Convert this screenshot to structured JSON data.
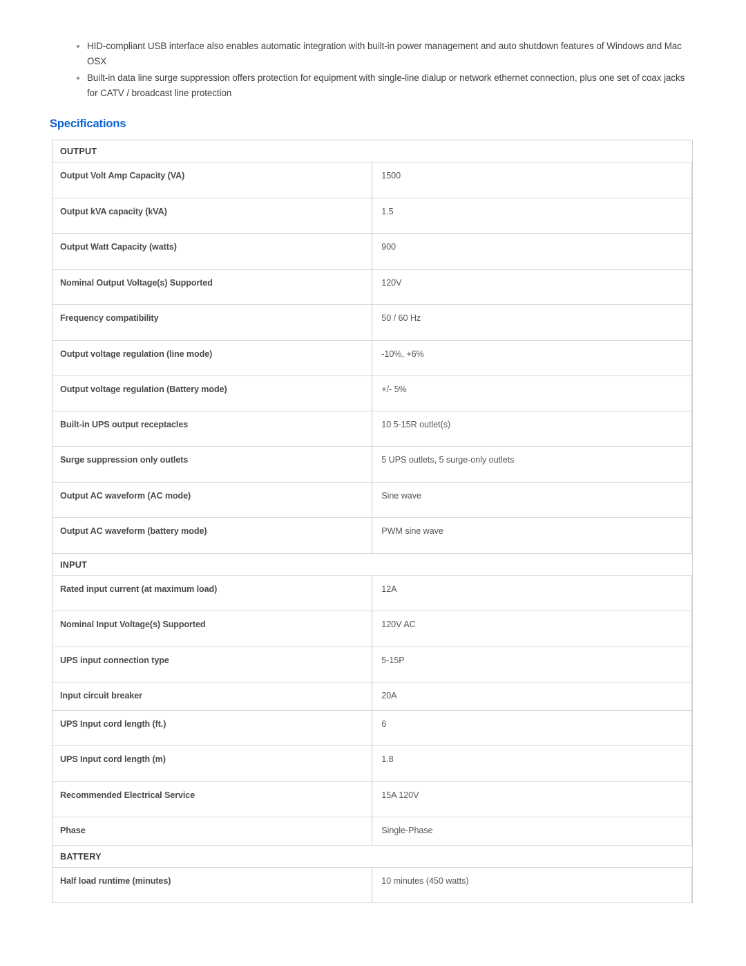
{
  "features": [
    "HID-compliant USB interface also enables automatic integration with built-in power management and auto shutdown features of Windows and Mac OSX",
    "Built-in data line surge suppression offers protection for equipment with single-line dialup or network ethernet connection, plus one set of coax jacks for CATV / broadcast line protection"
  ],
  "specifications": {
    "heading": "Specifications",
    "heading_color": "#0b63d0",
    "groups": [
      {
        "title": "OUTPUT",
        "rows": [
          {
            "label": "Output Volt Amp Capacity (VA)",
            "value": "1500"
          },
          {
            "label": "Output kVA capacity (kVA)",
            "value": "1.5"
          },
          {
            "label": "Output Watt Capacity (watts)",
            "value": "900"
          },
          {
            "label": "Nominal Output Voltage(s) Supported",
            "value": "120V"
          },
          {
            "label": "Frequency compatibility",
            "value": "50 / 60 Hz"
          },
          {
            "label": "Output voltage regulation (line mode)",
            "value": "-10%, +6%"
          },
          {
            "label": "Output voltage regulation (Battery mode)",
            "value": "+/- 5%"
          },
          {
            "label": "Built-in UPS output receptacles",
            "value": "10 5-15R outlet(s)"
          },
          {
            "label": "Surge suppression only outlets",
            "value": "5 UPS outlets, 5 surge-only outlets"
          },
          {
            "label": "Output AC waveform (AC mode)",
            "value": "Sine wave"
          },
          {
            "label": "Output AC waveform (battery mode)",
            "value": "PWM sine wave"
          }
        ]
      },
      {
        "title": "INPUT",
        "rows": [
          {
            "label": "Rated input current (at maximum load)",
            "value": "12A"
          },
          {
            "label": "Nominal Input Voltage(s) Supported",
            "value": "120V AC"
          },
          {
            "label": "UPS input connection type",
            "value": "5-15P"
          },
          {
            "label": "Input circuit breaker",
            "value": "20A"
          },
          {
            "label": "UPS Input cord length (ft.)",
            "value": "6"
          },
          {
            "label": "UPS Input cord length (m)",
            "value": "1.8"
          },
          {
            "label": "Recommended Electrical Service",
            "value": "15A 120V"
          },
          {
            "label": "Phase",
            "value": "Single-Phase"
          }
        ]
      },
      {
        "title": "BATTERY",
        "rows": [
          {
            "label": "Half load runtime (minutes)",
            "value": "10 minutes (450 watts)"
          }
        ]
      }
    ]
  }
}
